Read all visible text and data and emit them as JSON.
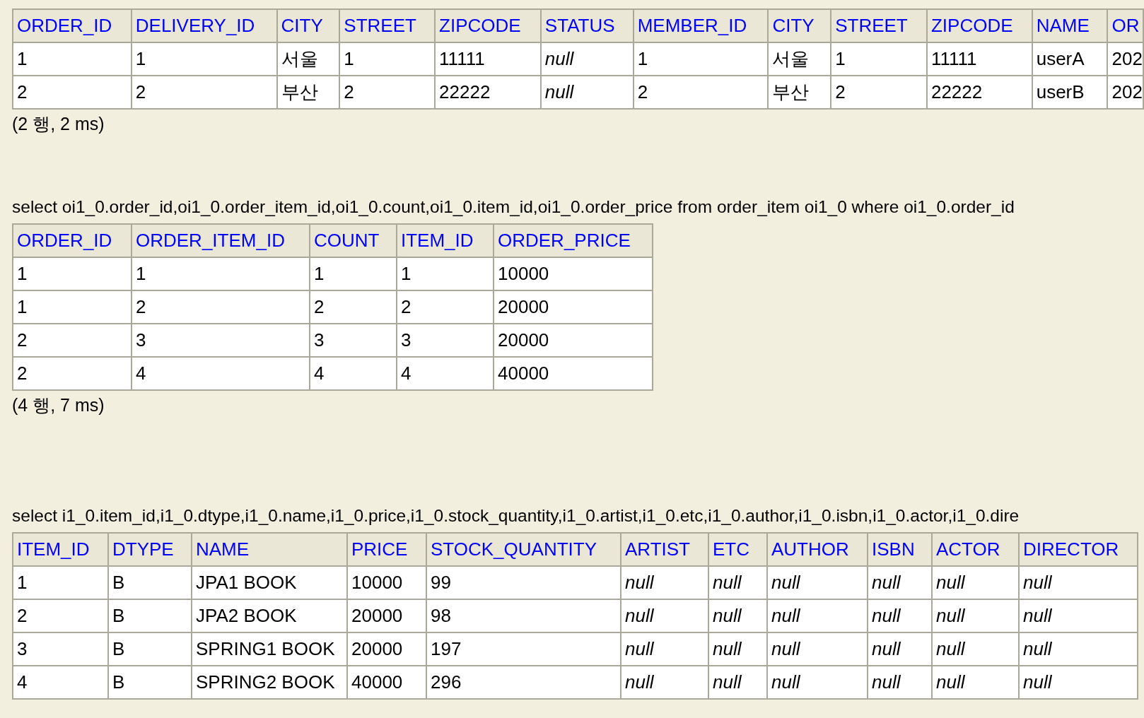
{
  "results": [
    {
      "columns": [
        "ORDER_ID",
        "DELIVERY_ID",
        "CITY",
        "STREET",
        "ZIPCODE",
        "STATUS",
        "MEMBER_ID",
        "CITY",
        "STREET",
        "ZIPCODE",
        "NAME",
        "OR"
      ],
      "rows": [
        [
          "1",
          "1",
          "서울",
          "1",
          "11111",
          {
            "text": "null",
            "kind": "null"
          },
          "1",
          "서울",
          "1",
          "11111",
          "userA",
          "202"
        ],
        [
          "2",
          "2",
          "부산",
          "2",
          "22222",
          {
            "text": "null",
            "kind": "null"
          },
          "2",
          "부산",
          "2",
          "22222",
          "userB",
          "202"
        ]
      ],
      "summary": "(2 행, 2 ms)"
    },
    {
      "query": "select oi1_0.order_id,oi1_0.order_item_id,oi1_0.count,oi1_0.item_id,oi1_0.order_price from order_item oi1_0 where oi1_0.order_id",
      "columns": [
        "ORDER_ID",
        "ORDER_ITEM_ID",
        "COUNT",
        "ITEM_ID",
        "ORDER_PRICE"
      ],
      "rows": [
        [
          "1",
          "1",
          "1",
          "1",
          "10000"
        ],
        [
          "1",
          "2",
          "2",
          "2",
          "20000"
        ],
        [
          "2",
          "3",
          "3",
          "3",
          "20000"
        ],
        [
          "2",
          "4",
          "4",
          "4",
          "40000"
        ]
      ],
      "summary": "(4 행, 7 ms)"
    },
    {
      "query": "select i1_0.item_id,i1_0.dtype,i1_0.name,i1_0.price,i1_0.stock_quantity,i1_0.artist,i1_0.etc,i1_0.author,i1_0.isbn,i1_0.actor,i1_0.dire",
      "columns": [
        "ITEM_ID",
        "DTYPE",
        "NAME",
        "PRICE",
        "STOCK_QUANTITY",
        "ARTIST",
        "ETC",
        "AUTHOR",
        "ISBN",
        "ACTOR",
        "DIRECTOR"
      ],
      "rows": [
        [
          "1",
          "B",
          "JPA1 BOOK",
          "10000",
          "99",
          {
            "text": "null",
            "kind": "null"
          },
          {
            "text": "null",
            "kind": "null"
          },
          {
            "text": "null",
            "kind": "null"
          },
          {
            "text": "null",
            "kind": "null"
          },
          {
            "text": "null",
            "kind": "null"
          },
          {
            "text": "null",
            "kind": "null"
          }
        ],
        [
          "2",
          "B",
          "JPA2 BOOK",
          "20000",
          "98",
          {
            "text": "null",
            "kind": "null"
          },
          {
            "text": "null",
            "kind": "null"
          },
          {
            "text": "null",
            "kind": "null"
          },
          {
            "text": "null",
            "kind": "null"
          },
          {
            "text": "null",
            "kind": "null"
          },
          {
            "text": "null",
            "kind": "null"
          }
        ],
        [
          "3",
          "B",
          "SPRING1 BOOK",
          "20000",
          "197",
          {
            "text": "null",
            "kind": "null"
          },
          {
            "text": "null",
            "kind": "null"
          },
          {
            "text": "null",
            "kind": "null"
          },
          {
            "text": "null",
            "kind": "null"
          },
          {
            "text": "null",
            "kind": "null"
          },
          {
            "text": "null",
            "kind": "null"
          }
        ],
        [
          "4",
          "B",
          "SPRING2 BOOK",
          "40000",
          "296",
          {
            "text": "null",
            "kind": "null"
          },
          {
            "text": "null",
            "kind": "null"
          },
          {
            "text": "null",
            "kind": "null"
          },
          {
            "text": "null",
            "kind": "null"
          },
          {
            "text": "null",
            "kind": "null"
          },
          {
            "text": "null",
            "kind": "null"
          }
        ]
      ]
    }
  ]
}
